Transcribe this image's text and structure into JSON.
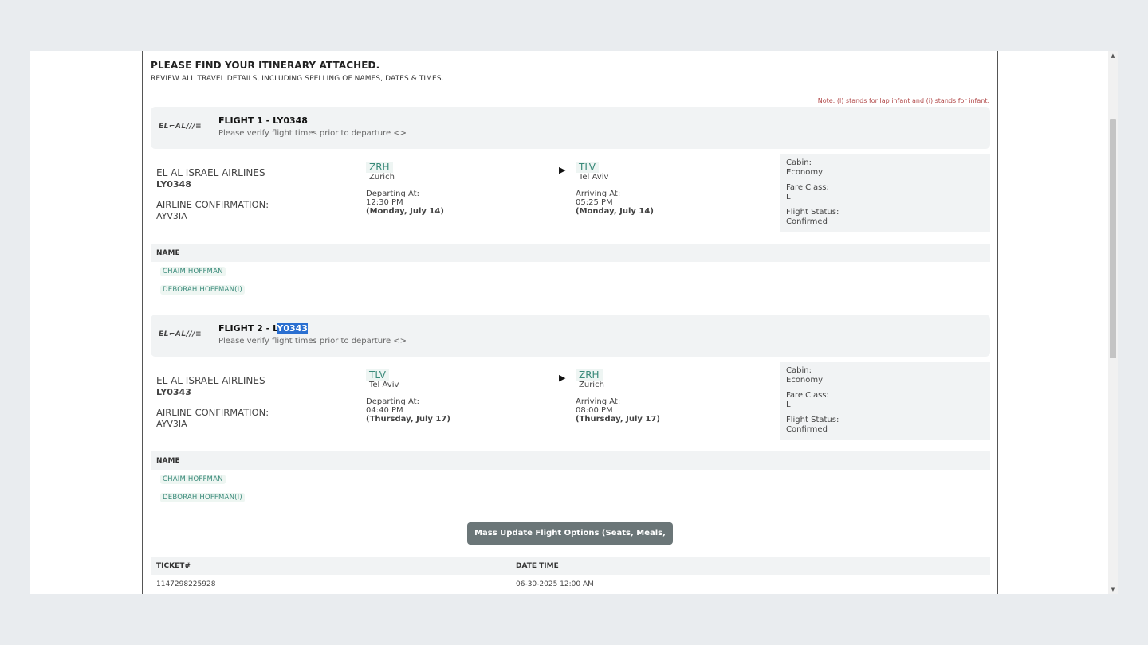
{
  "header": {
    "title": "PLEASE FIND YOUR ITINERARY ATTACHED.",
    "subtitle": "REVIEW ALL TRAVEL DETAILS, INCLUDING SPELLING OF NAMES, DATES & TIMES.",
    "note": "Note: (l) stands for lap infant and (i) stands for infant."
  },
  "flights": [
    {
      "logo": "ELⅦAL℘⭒≡",
      "title_prefix": "FLIGHT 1 - LY0348",
      "verify": "Please verify flight times prior to departure <>",
      "airline": "EL AL ISRAEL AIRLINES",
      "code": "LY0348",
      "conf_label": "AIRLINE CONFIRMATION:",
      "conf": "AYV3IA",
      "dep_iata": "ZRH",
      "dep_city": "Zurich",
      "dep_label": "Departing At:",
      "dep_time": "12:30 PM",
      "dep_date": "(Monday, July 14)",
      "arr_iata": "TLV",
      "arr_city": "Tel Aviv",
      "arr_label": "Arriving At:",
      "arr_time": "05:25 PM",
      "arr_date": "(Monday, July 14)",
      "cabin_label": "Cabin:",
      "cabin": "Economy",
      "fare_label": "Fare Class:",
      "fare": "L",
      "status_label": "Flight Status:",
      "status": "Confirmed",
      "name_header": "NAME",
      "passengers": [
        "CHAIM HOFFMAN",
        "DEBORAH HOFFMAN(I)"
      ]
    },
    {
      "logo": "ELⅦAL℘⭒≡",
      "title_prefix": "FLIGHT 2 - L",
      "title_selected": "Y0343",
      "verify": "Please verify flight times prior to departure <>",
      "airline": "EL AL ISRAEL AIRLINES",
      "code": "LY0343",
      "conf_label": "AIRLINE CONFIRMATION:",
      "conf": "AYV3IA",
      "dep_iata": "TLV",
      "dep_city": "Tel Aviv",
      "dep_label": "Departing At:",
      "dep_time": "04:40 PM",
      "dep_date": "(Thursday, July 17)",
      "arr_iata": "ZRH",
      "arr_city": "Zurich",
      "arr_label": "Arriving At:",
      "arr_time": "08:00 PM",
      "arr_date": "(Thursday, July 17)",
      "cabin_label": "Cabin:",
      "cabin": "Economy",
      "fare_label": "Fare Class:",
      "fare": "L",
      "status_label": "Flight Status:",
      "status": "Confirmed",
      "name_header": "NAME",
      "passengers": [
        "CHAIM HOFFMAN",
        "DEBORAH HOFFMAN(I)"
      ]
    }
  ],
  "mass_update_label": "Mass Update Flight Options (Seats, Meals, Bags)",
  "tickets": {
    "headers": [
      "TICKET#",
      "DATE TIME"
    ],
    "rows": [
      [
        "1147298225928",
        "06-30-2025 12:00 AM"
      ]
    ]
  },
  "icons": {
    "arrow": "play-arrow-icon",
    "logo": "el-al-logo-icon"
  }
}
